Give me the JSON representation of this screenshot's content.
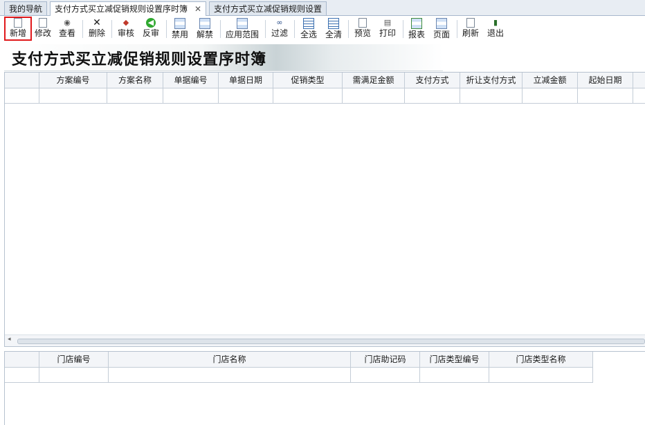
{
  "tabs": [
    {
      "label": "我的导航",
      "active": false
    },
    {
      "label": "支付方式买立减促销规则设置序时簿",
      "active": true,
      "close": "✕"
    },
    {
      "label": "支付方式买立减促销规则设置",
      "active": false
    }
  ],
  "toolbar": [
    {
      "label": "新增",
      "icon": "new-document-icon"
    },
    {
      "label": "修改",
      "icon": "edit-icon"
    },
    {
      "label": "查看",
      "icon": "view-icon"
    },
    {
      "label": "删除",
      "icon": "delete-x-icon"
    },
    {
      "label": "审核",
      "icon": "audit-icon"
    },
    {
      "label": "反审",
      "icon": "reverse-audit-icon"
    },
    {
      "label": "禁用",
      "icon": "disable-icon"
    },
    {
      "label": "解禁",
      "icon": "enable-icon"
    },
    {
      "label": "应用范围",
      "icon": "scope-icon"
    },
    {
      "label": "过滤",
      "icon": "filter-binoculars-icon"
    },
    {
      "label": "全选",
      "icon": "select-all-icon"
    },
    {
      "label": "全清",
      "icon": "clear-all-icon"
    },
    {
      "label": "预览",
      "icon": "preview-icon"
    },
    {
      "label": "打印",
      "icon": "print-icon"
    },
    {
      "label": "报表",
      "icon": "report-icon"
    },
    {
      "label": "页面",
      "icon": "page-icon"
    },
    {
      "label": "刷新",
      "icon": "refresh-icon"
    },
    {
      "label": "退出",
      "icon": "exit-icon"
    }
  ],
  "page_title": "支付方式买立减促销规则设置序时簿",
  "main_grid": {
    "columns": [
      "方案编号",
      "方案名称",
      "单据编号",
      "单据日期",
      "促销类型",
      "需满足金额",
      "支付方式",
      "折让支付方式",
      "立减金额",
      "起始日期"
    ],
    "rows": []
  },
  "store_grid": {
    "columns": [
      "门店编号",
      "门店名称",
      "门店助记码",
      "门店类型编号",
      "门店类型名称"
    ],
    "rows": []
  },
  "scroll_left": "◂"
}
